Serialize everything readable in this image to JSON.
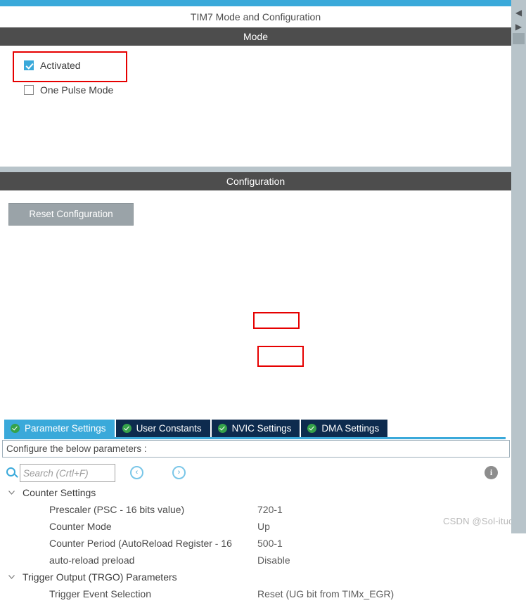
{
  "window": {
    "title": "TIM7 Mode and Configuration",
    "accent_color": "#3aa9da",
    "header_bar_color": "#4d4d4d",
    "highlight_color": "#e60000"
  },
  "mode": {
    "header": "Mode",
    "checkboxes": [
      {
        "label": "Activated",
        "checked": true,
        "highlighted": true
      },
      {
        "label": "One Pulse Mode",
        "checked": false,
        "highlighted": false
      }
    ]
  },
  "configuration": {
    "header": "Configuration",
    "reset_button": "Reset Configuration",
    "tabs": [
      {
        "label": "Parameter Settings",
        "active": true,
        "icon": "green-check-icon"
      },
      {
        "label": "User Constants",
        "active": false,
        "icon": "green-check-icon"
      },
      {
        "label": "NVIC Settings",
        "active": false,
        "icon": "green-check-icon"
      },
      {
        "label": "DMA Settings",
        "active": false,
        "icon": "green-check-icon"
      }
    ],
    "notice": "Configure the below parameters :",
    "toolbar": {
      "search_icon": "search-icon",
      "search_value": "",
      "search_placeholder": "Search (Crtl+F)",
      "prev_label": "‹",
      "next_label": "›",
      "info_label": "i"
    },
    "groups": [
      {
        "name": "Counter Settings",
        "expanded": true,
        "rows": [
          {
            "label": "Prescaler (PSC - 16 bits value)",
            "value": "720-1",
            "highlighted": true
          },
          {
            "label": "Counter Mode",
            "value": "Up",
            "highlighted": false
          },
          {
            "label": "Counter Period (AutoReload Register - 16",
            "value": "500-1",
            "highlighted": true
          },
          {
            "label": "auto-reload preload",
            "value": "Disable",
            "highlighted": false
          }
        ]
      },
      {
        "name": "Trigger Output (TRGO) Parameters",
        "expanded": true,
        "rows": [
          {
            "label": "Trigger Event Selection",
            "value": "Reset (UG bit from TIMx_EGR)",
            "highlighted": false
          }
        ]
      }
    ]
  },
  "scrollbar": {
    "up_label": "◀",
    "down_label": "▶"
  },
  "watermark": "CSDN @Sol-itude"
}
